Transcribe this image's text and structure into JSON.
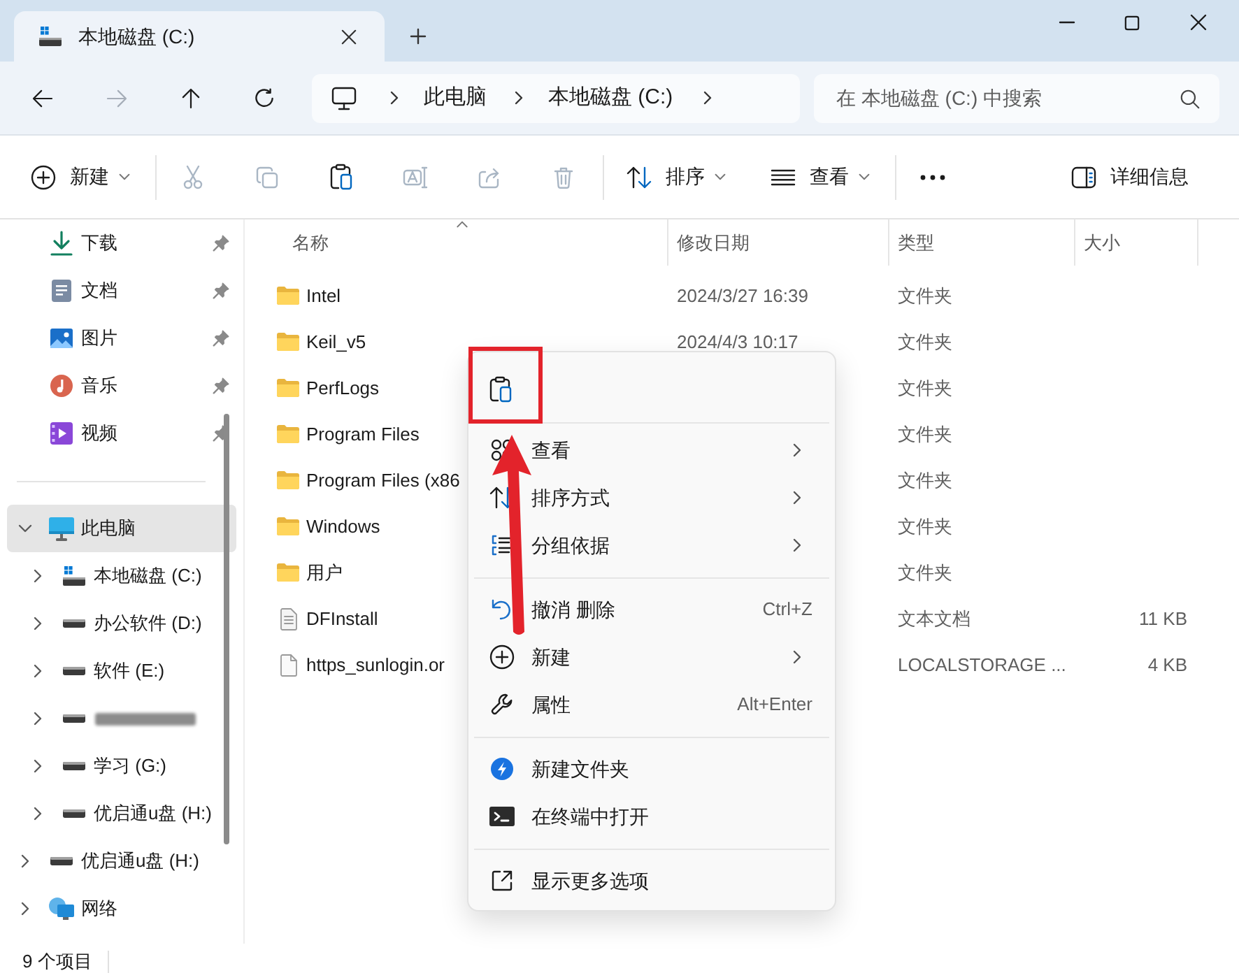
{
  "window": {
    "tabs": [
      {
        "label": "本地磁盘 (C:)",
        "selected": true
      }
    ]
  },
  "navigation": {
    "buttons": [
      {
        "kind": "back",
        "disabled": false
      },
      {
        "kind": "forward",
        "disabled": true
      },
      {
        "kind": "up",
        "disabled": false
      },
      {
        "kind": "refresh",
        "disabled": false
      }
    ],
    "breadcrumb": [
      "此电脑",
      "本地磁盘 (C:)"
    ],
    "search": {
      "placeholder": "在 本地磁盘 (C:) 中搜索"
    }
  },
  "toolbar": {
    "items": [
      {
        "kind": "new",
        "label": "新建",
        "dropdown": true,
        "disabled": false
      },
      {
        "kind": "separator"
      },
      {
        "kind": "cut",
        "disabled": true
      },
      {
        "kind": "copy",
        "disabled": true
      },
      {
        "kind": "paste",
        "disabled": false
      },
      {
        "kind": "rename",
        "disabled": true
      },
      {
        "kind": "share",
        "disabled": true
      },
      {
        "kind": "delete",
        "disabled": true
      },
      {
        "kind": "separator"
      },
      {
        "kind": "sort",
        "label": "排序",
        "dropdown": true,
        "disabled": false
      },
      {
        "kind": "view",
        "label": "查看",
        "dropdown": true,
        "disabled": false
      },
      {
        "kind": "separator"
      },
      {
        "kind": "more",
        "disabled": false
      }
    ],
    "details": {
      "label": "详细信息"
    }
  },
  "sidebar": {
    "quick_access": [
      {
        "kind": "downloads",
        "label": "下载",
        "pinned": true,
        "selected": false
      },
      {
        "kind": "documents",
        "label": "文档",
        "pinned": true,
        "selected": false
      },
      {
        "kind": "pictures",
        "label": "图片",
        "pinned": true,
        "selected": false
      },
      {
        "kind": "music",
        "label": "音乐",
        "pinned": true,
        "selected": false
      },
      {
        "kind": "videos",
        "label": "视频",
        "pinned": true,
        "selected": false
      }
    ],
    "tree": [
      {
        "kind": "pc",
        "label": "此电脑",
        "expanded": true,
        "selected": true,
        "children": [
          {
            "kind": "system-drive",
            "label": "本地磁盘 (C:)",
            "expanded": false,
            "selected": false
          },
          {
            "kind": "drive",
            "label": "办公软件 (D:)",
            "expanded": false,
            "selected": false
          },
          {
            "kind": "drive",
            "label": "软件 (E:)",
            "expanded": false,
            "selected": false
          },
          {
            "kind": "blurred-drive",
            "expanded": false,
            "selected": false
          },
          {
            "kind": "drive",
            "label": "学习 (G:)",
            "expanded": false,
            "selected": false
          },
          {
            "kind": "drive",
            "label": "优启通u盘 (H:)",
            "expanded": false,
            "selected": false
          }
        ]
      },
      {
        "kind": "drive",
        "label": "优启通u盘 (H:)",
        "expanded": false,
        "selected": false
      },
      {
        "kind": "network",
        "label": "网络",
        "expanded": false,
        "selected": false
      }
    ]
  },
  "file_list": {
    "columns": [
      {
        "label": "名称",
        "sorted": true
      },
      {
        "label": "修改日期",
        "sorted": false
      },
      {
        "label": "类型",
        "sorted": false
      },
      {
        "label": "大小",
        "sorted": false
      }
    ],
    "rows": [
      {
        "kind": "folder",
        "name": "Intel",
        "modified": "2024/3/27 16:39",
        "type": "文件夹"
      },
      {
        "kind": "folder",
        "name": "Keil_v5",
        "modified": "2024/4/3 10:17",
        "type": "文件夹"
      },
      {
        "kind": "folder",
        "name": "PerfLogs",
        "type": "文件夹"
      },
      {
        "kind": "folder",
        "name": "Program Files",
        "type": "文件夹"
      },
      {
        "kind": "folder",
        "name": "Program Files (x86",
        "type": "文件夹"
      },
      {
        "kind": "folder",
        "name": "Windows",
        "type": "文件夹"
      },
      {
        "kind": "folder",
        "name": "用户",
        "type": "文件夹"
      },
      {
        "kind": "text-file",
        "name": "DFInstall",
        "type": "文本文档",
        "size": "11 KB"
      },
      {
        "kind": "file",
        "name": "https_sunlogin.or",
        "type": "LOCALSTORAGE ...",
        "size": "4 KB"
      }
    ]
  },
  "status_bar": {
    "text": "9 个项目"
  },
  "context_menu": {
    "actions": [
      {
        "kind": "paste",
        "highlighted": true,
        "arrow": true
      }
    ],
    "items": [
      {
        "kind": "view",
        "label": "查看",
        "submenu": true
      },
      {
        "kind": "sort",
        "label": "排序方式",
        "submenu": true
      },
      {
        "kind": "group",
        "label": "分组依据",
        "submenu": true
      },
      {
        "kind": "separator"
      },
      {
        "kind": "undo",
        "label": "撤消 删除",
        "shortcut": "Ctrl+Z",
        "submenu": false
      },
      {
        "kind": "new",
        "label": "新建",
        "submenu": true
      },
      {
        "kind": "properties",
        "label": "属性",
        "shortcut": "Alt+Enter",
        "submenu": false
      },
      {
        "kind": "separator"
      },
      {
        "kind": "new-folder-app",
        "label": "新建文件夹",
        "submenu": false
      },
      {
        "kind": "terminal",
        "label": "在终端中打开",
        "submenu": false
      },
      {
        "kind": "separator"
      },
      {
        "kind": "more-options",
        "label": "显示更多选项",
        "submenu": false
      }
    ]
  }
}
